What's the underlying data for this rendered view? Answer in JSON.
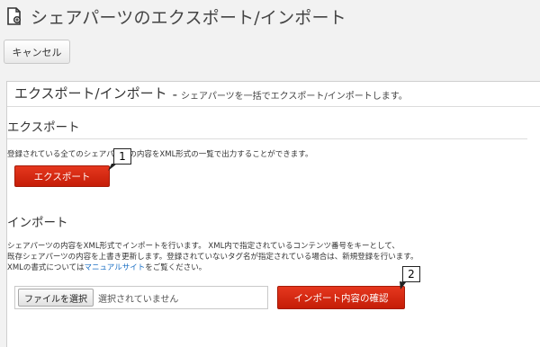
{
  "window": {
    "title": "シェアパーツのエクスポート/インポート"
  },
  "toolbar": {
    "cancel_label": "キャンセル"
  },
  "panel": {
    "heading": "エクスポート/インポート",
    "separator": "-",
    "subheading": "シェアパーツを一括でエクスポート/インポートします。"
  },
  "export": {
    "title": "エクスポート",
    "description": "登録されている全てのシェアパーツの内容をXML形式の一覧で出力することができます。",
    "button_label": "エクスポート"
  },
  "import": {
    "title": "インポート",
    "description_line1": "シェアパーツの内容をXML形式でインポートを行います。 XML内で指定されているコンテンツ番号をキーとして、",
    "description_line2": "既存シェアパーツの内容を上書き更新します。登録されていないタグ名が指定されている場合は、新規登録を行います。",
    "description_line3_pre": "XMLの書式については",
    "description_line3_link": "マニュアルサイト",
    "description_line3_post": "をご覧ください。",
    "file_button_label": "ファイルを選択",
    "file_status": "選択されていません",
    "confirm_button_label": "インポート内容の確認"
  },
  "callouts": {
    "one": "1",
    "two": "2"
  },
  "colors": {
    "button_red": "#d0250e",
    "link_blue": "#1a6fc4",
    "background": "#f2f2f2"
  }
}
